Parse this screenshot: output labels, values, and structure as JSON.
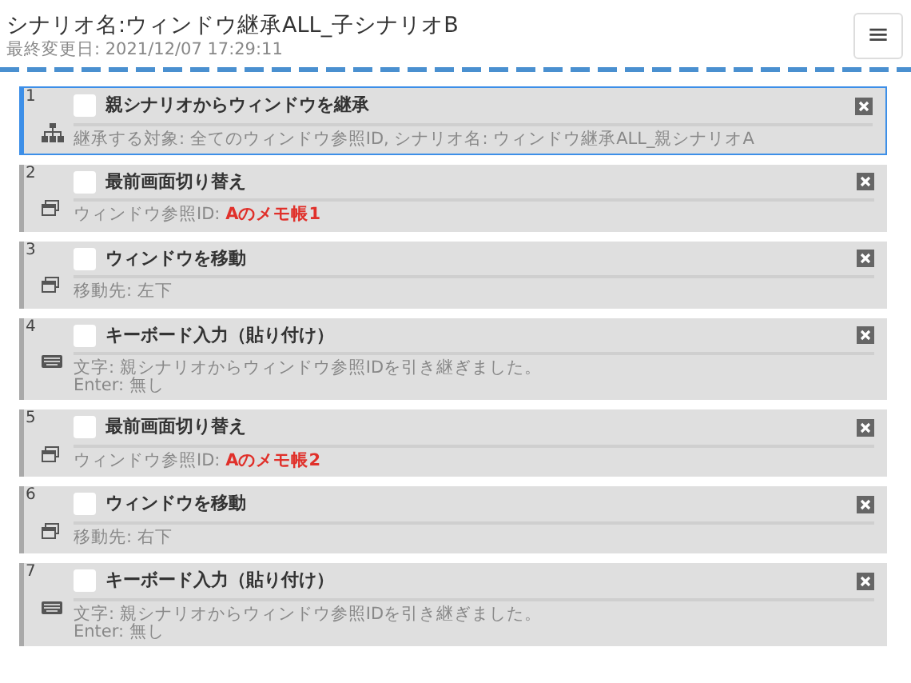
{
  "header": {
    "title": "シナリオ名:ウィンドウ継承ALL_子シナリオB",
    "subtitle": "最終変更日: 2021/12/07 17:29:11",
    "menu_button": "≡"
  },
  "steps": [
    {
      "number": "1",
      "kind": "inherit",
      "title": "親シナリオからウィンドウを継承",
      "checked": false,
      "selected": true,
      "lines": [
        {
          "label": "継承する対象: 全てのウィンドウ参照ID, シナリオ名: ウィンドウ継承ALL_親シナリオA"
        }
      ]
    },
    {
      "number": "2",
      "kind": "window",
      "title": "最前画面切り替え",
      "checked": false,
      "selected": false,
      "lines": [
        {
          "label": "ウィンドウ参照ID: ",
          "value": "Aのメモ帳1"
        }
      ]
    },
    {
      "number": "3",
      "kind": "window",
      "title": "ウィンドウを移動",
      "checked": false,
      "selected": false,
      "lines": [
        {
          "label": "移動先: 左下"
        }
      ]
    },
    {
      "number": "4",
      "kind": "keyboard",
      "title": "キーボード入力（貼り付け）",
      "checked": false,
      "selected": false,
      "lines": [
        {
          "label": "文字: 親シナリオからウィンドウ参照IDを引き継ぎました。"
        },
        {
          "label": "Enter: 無し"
        }
      ]
    },
    {
      "number": "5",
      "kind": "window",
      "title": "最前画面切り替え",
      "checked": false,
      "selected": false,
      "lines": [
        {
          "label": "ウィンドウ参照ID: ",
          "value": "Aのメモ帳2"
        }
      ]
    },
    {
      "number": "6",
      "kind": "window",
      "title": "ウィンドウを移動",
      "checked": false,
      "selected": false,
      "lines": [
        {
          "label": "移動先: 右下"
        }
      ]
    },
    {
      "number": "7",
      "kind": "keyboard",
      "title": "キーボード入力（貼り付け）",
      "checked": false,
      "selected": false,
      "lines": [
        {
          "label": "文字: 親シナリオからウィンドウ参照IDを引き継ぎました。"
        },
        {
          "label": "Enter: 無し"
        }
      ]
    }
  ]
}
